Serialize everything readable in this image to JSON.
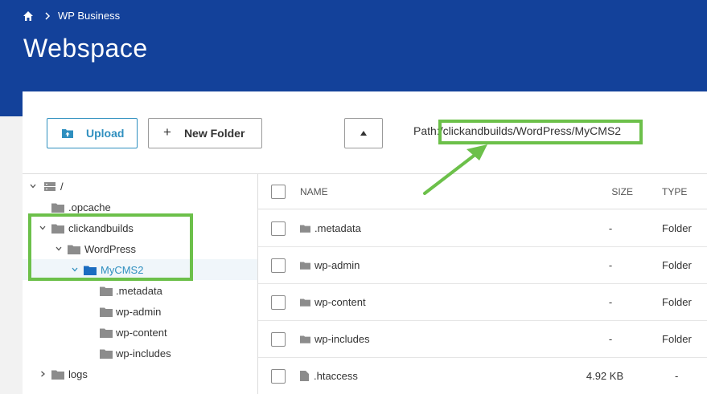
{
  "breadcrumb": {
    "home_icon": "home-icon",
    "item": "WP Business"
  },
  "page_title": "Webspace",
  "toolbar": {
    "upload_label": "Upload",
    "new_folder_label": "New Folder",
    "up_icon": "triangle-up-icon"
  },
  "path": {
    "label": "Path:",
    "value": "/clickandbuilds/WordPress/MyCMS2"
  },
  "tree": {
    "root": "/",
    "items": [
      {
        "label": ".opcache"
      },
      {
        "label": "clickandbuilds"
      },
      {
        "label": "WordPress"
      },
      {
        "label": "MyCMS2"
      },
      {
        "label": ".metadata"
      },
      {
        "label": "wp-admin"
      },
      {
        "label": "wp-content"
      },
      {
        "label": "wp-includes"
      },
      {
        "label": "logs"
      }
    ]
  },
  "list": {
    "headers": {
      "name": "NAME",
      "size": "SIZE",
      "type": "TYPE"
    },
    "rows": [
      {
        "name": ".metadata",
        "size": "-",
        "type": "Folder"
      },
      {
        "name": "wp-admin",
        "size": "-",
        "type": "Folder"
      },
      {
        "name": "wp-content",
        "size": "-",
        "type": "Folder"
      },
      {
        "name": "wp-includes",
        "size": "-",
        "type": "Folder"
      },
      {
        "name": ".htaccess",
        "size": "4.92 KB",
        "type": "-"
      }
    ]
  },
  "colors": {
    "header": "#13419a",
    "accent": "#2f8fbf",
    "highlight": "#6cc04a"
  }
}
